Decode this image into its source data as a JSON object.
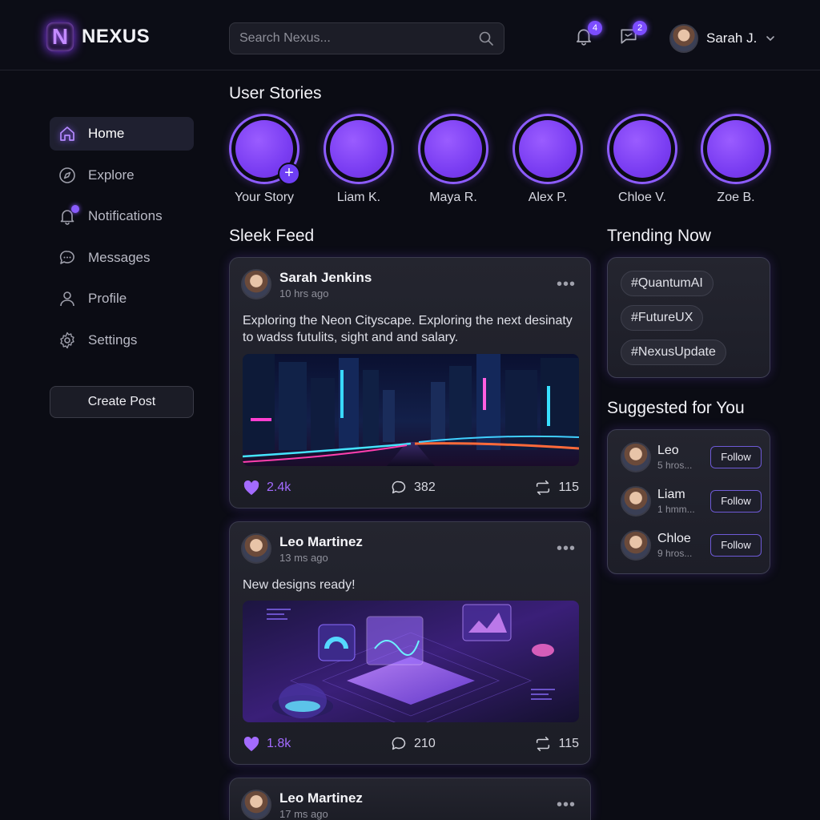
{
  "app": {
    "name": "NEXUS",
    "logo_letter": "N"
  },
  "search": {
    "placeholder": "Search Nexus..."
  },
  "header": {
    "notifications_count": "4",
    "messages_count": "2",
    "user_name": "Sarah J."
  },
  "sidebar": {
    "items": [
      {
        "label": "Home",
        "icon": "home-icon",
        "active": true
      },
      {
        "label": "Explore",
        "icon": "compass-icon"
      },
      {
        "label": "Notifications",
        "icon": "bell-icon"
      },
      {
        "label": "Messages",
        "icon": "chat-icon"
      },
      {
        "label": "Profile",
        "icon": "user-icon"
      },
      {
        "label": "Settings",
        "icon": "gear-icon"
      }
    ],
    "create_label": "Create Post"
  },
  "stories": {
    "title": "User Stories",
    "items": [
      "Your Story",
      "Liam K.",
      "Maya R.",
      "Alex P.",
      "Chloe V.",
      "Zoe B."
    ]
  },
  "feed": {
    "title": "Sleek Feed",
    "posts": [
      {
        "author": "Sarah Jenkins",
        "time": "10 hrs ago",
        "text": "Exploring the Neon Cityscape. Exploring the next desinaty to wadss futulits, sight and and salary.",
        "likes": "2.4k",
        "comments": "382",
        "shares": "115"
      },
      {
        "author": "Leo Martinez",
        "time": "13 ms ago",
        "text": "New designs ready!",
        "likes": "1.8k",
        "comments": "210",
        "shares": "115"
      },
      {
        "author": "Leo Martinez",
        "time": "17 ms ago"
      }
    ]
  },
  "trending": {
    "title": "Trending Now",
    "tags": [
      "#QuantumAI",
      "#FutureUX",
      "#NexusUpdate"
    ]
  },
  "suggested": {
    "title": "Suggested for You",
    "users": [
      {
        "name": "Leo",
        "sub": "5 hros...",
        "button": "Follow"
      },
      {
        "name": "Liam",
        "sub": "1 hmm...",
        "button": "Follow"
      },
      {
        "name": "Chloe",
        "sub": "9 hros...",
        "button": "Follow"
      }
    ]
  },
  "colors": {
    "accent": "#8a5cff",
    "background": "#0b0c14",
    "card": "#22232d"
  }
}
